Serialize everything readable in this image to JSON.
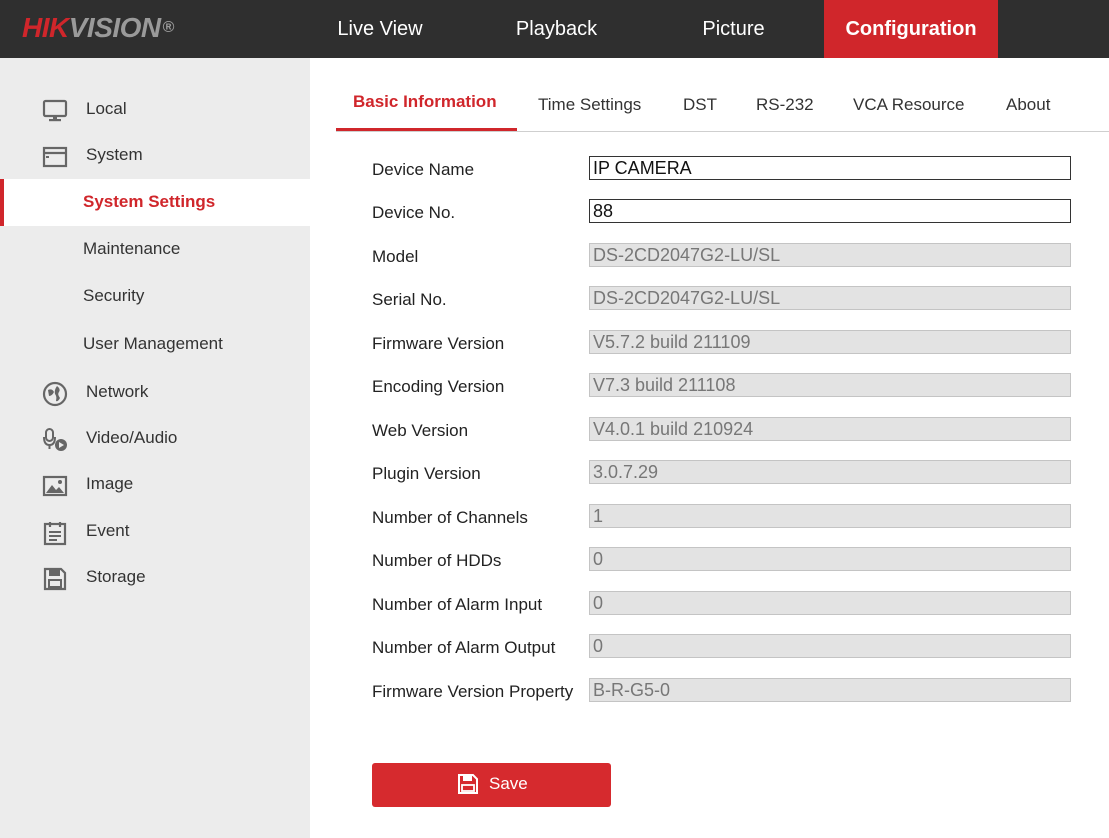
{
  "header": {
    "logo_text_red": "HIK",
    "logo_text_grey": "VISION",
    "logo_reg": "®",
    "nav": [
      {
        "label": "Live View"
      },
      {
        "label": "Playback"
      },
      {
        "label": "Picture"
      },
      {
        "label": "Configuration",
        "active": true
      }
    ]
  },
  "sidebar": {
    "items": [
      {
        "label": "Local",
        "icon": "monitor-icon"
      },
      {
        "label": "System",
        "icon": "system-window-icon"
      },
      {
        "label": "Network",
        "icon": "globe-icon"
      },
      {
        "label": "Video/Audio",
        "icon": "microphone-camera-icon"
      },
      {
        "label": "Image",
        "icon": "image-icon"
      },
      {
        "label": "Event",
        "icon": "calendar-icon"
      },
      {
        "label": "Storage",
        "icon": "disk-icon"
      }
    ],
    "system_subitems": [
      {
        "label": "System Settings",
        "active": true
      },
      {
        "label": "Maintenance"
      },
      {
        "label": "Security"
      },
      {
        "label": "User Management"
      }
    ]
  },
  "tabs": [
    {
      "label": "Basic Information",
      "active": true
    },
    {
      "label": "Time Settings"
    },
    {
      "label": "DST"
    },
    {
      "label": "RS-232"
    },
    {
      "label": "VCA Resource"
    },
    {
      "label": "About"
    }
  ],
  "form": {
    "fields": [
      {
        "label": "Device Name",
        "value": "IP CAMERA",
        "editable": true
      },
      {
        "label": "Device No.",
        "value": "88",
        "editable": true
      },
      {
        "label": "Model",
        "value": "DS-2CD2047G2-LU/SL",
        "editable": false
      },
      {
        "label": "Serial No.",
        "value": "DS-2CD2047G2-LU/SL",
        "editable": false
      },
      {
        "label": "Firmware Version",
        "value": "V5.7.2 build 211109",
        "editable": false
      },
      {
        "label": "Encoding Version",
        "value": "V7.3 build 211108",
        "editable": false
      },
      {
        "label": "Web Version",
        "value": "V4.0.1 build 210924",
        "editable": false
      },
      {
        "label": "Plugin Version",
        "value": "3.0.7.29",
        "editable": false
      },
      {
        "label": "Number of Channels",
        "value": "1",
        "editable": false
      },
      {
        "label": "Number of HDDs",
        "value": "0",
        "editable": false
      },
      {
        "label": "Number of Alarm Input",
        "value": "0",
        "editable": false
      },
      {
        "label": "Number of Alarm Output",
        "value": "0",
        "editable": false
      },
      {
        "label": "Firmware Version Property",
        "value": "B-R-G5-0",
        "editable": false
      }
    ],
    "save_label": "Save"
  },
  "colors": {
    "accent": "#d0262b",
    "topbar": "#2f2f2f",
    "sidebar_bg": "#ececec",
    "readonly_bg": "#e3e3e3"
  }
}
